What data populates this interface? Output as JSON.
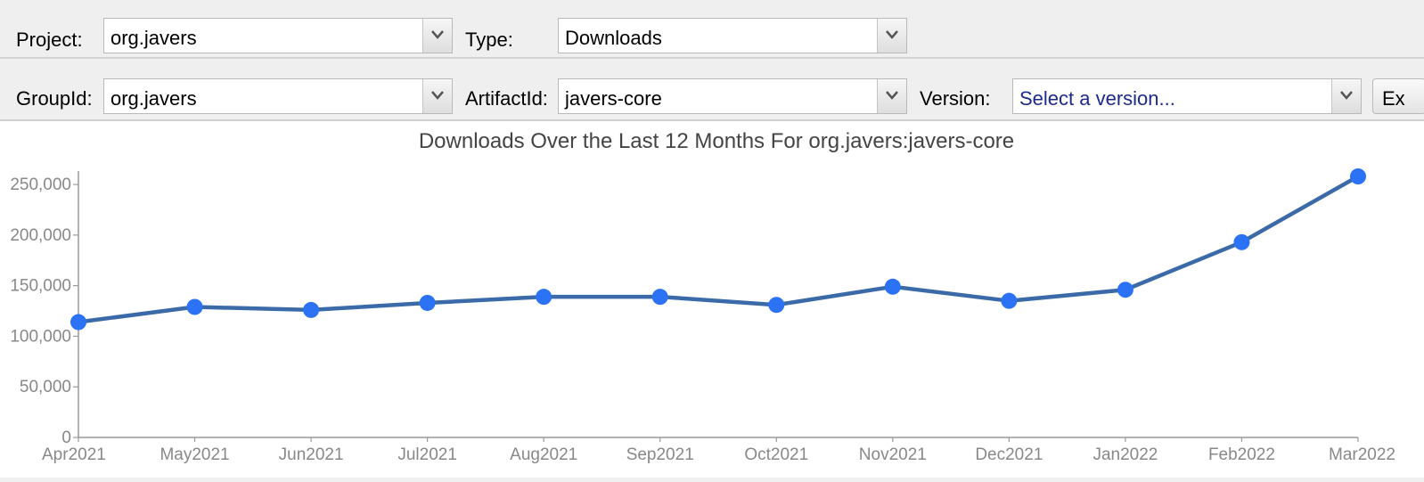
{
  "toolbar_top": {
    "project_label": "Project:",
    "project_value": "org.javers",
    "type_label": "Type:",
    "type_value": "Downloads"
  },
  "toolbar_bottom": {
    "groupid_label": "GroupId:",
    "groupid_value": "org.javers",
    "artifactid_label": "ArtifactId:",
    "artifactid_value": "javers-core",
    "version_label": "Version:",
    "version_placeholder": "Select a version...",
    "cutoff_button_label": "Ex"
  },
  "icons": {
    "combo_arrow": "chevron-down-icon"
  },
  "colors": {
    "line": "#3b6aa8",
    "marker": "#2b73f4",
    "placeholder_text": "#1c2a8a"
  },
  "chart_data": {
    "type": "line",
    "title": "Downloads Over the Last 12 Months For org.javers:javers-core",
    "xlabel": "",
    "ylabel": "",
    "categories": [
      "Apr2021",
      "May2021",
      "Jun2021",
      "Jul2021",
      "Aug2021",
      "Sep2021",
      "Oct2021",
      "Nov2021",
      "Dec2021",
      "Jan2022",
      "Feb2022",
      "Mar2022"
    ],
    "series": [
      {
        "values": [
          114000,
          129000,
          126000,
          133000,
          139000,
          139000,
          131000,
          149000,
          135000,
          146000,
          193000,
          258000
        ]
      }
    ],
    "yticks": [
      0,
      50000,
      100000,
      150000,
      200000,
      250000
    ],
    "ytick_labels": [
      "0",
      "50,000",
      "100,000",
      "150,000",
      "200,000",
      "250,000"
    ],
    "ylim": [
      0,
      258000
    ],
    "grid": false,
    "legend": "none"
  }
}
